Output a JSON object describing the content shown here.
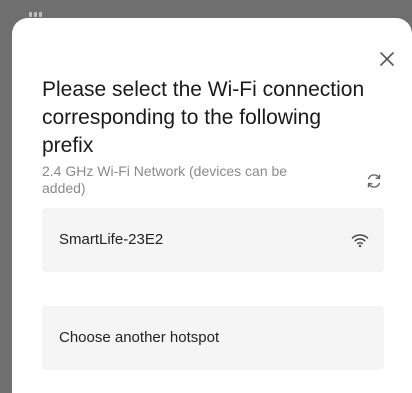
{
  "dialog": {
    "title": "Please select the Wi-Fi connection corresponding to the following prefix",
    "subtitle": "2.4 GHz Wi-Fi Network (devices can be added)",
    "close_icon": "close-icon",
    "refresh_icon": "refresh-icon"
  },
  "networks": [
    {
      "ssid": "SmartLife-23E2",
      "icon": "wifi-icon"
    }
  ],
  "other_option": {
    "label": "Choose another hotspot"
  }
}
